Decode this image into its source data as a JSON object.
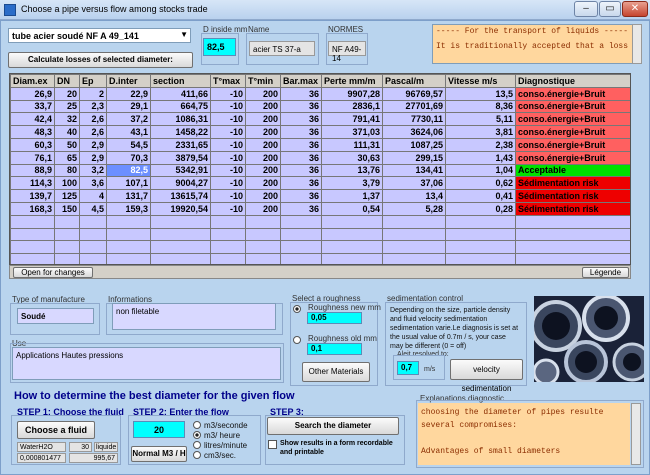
{
  "window": {
    "title": "Choose a pipe versus flow among stocks trade"
  },
  "stock": {
    "selected": "tube acier soudé NF A 49_141"
  },
  "dinside": {
    "label": "D inside mm",
    "value": "82,5"
  },
  "name": {
    "label": "Name",
    "value": "acier TS 37-a"
  },
  "normes": {
    "label": "NORMES",
    "value": "NF A49-14"
  },
  "notes": {
    "line1": "----- For the transport of liquids -----",
    "line2": "It is traditionally accepted that a loss of linear"
  },
  "calc_button": "Calculate losses of selected diameter:",
  "table": {
    "headers": [
      "Diam.ex",
      "DN",
      "Ep",
      "D.inter",
      "section",
      "T°max",
      "T°min",
      "Bar.max",
      "Perte mm/m",
      "Pascal/m",
      "Vitesse m/s",
      "Diagnostique"
    ],
    "rows": [
      {
        "cells": [
          "26,9",
          "20",
          "2",
          "22,9",
          "411,66",
          "-10",
          "200",
          "36",
          "9907,28",
          "96769,57",
          "13,5"
        ],
        "diag": "conso.énergie+Bruit",
        "status": "bad"
      },
      {
        "cells": [
          "33,7",
          "25",
          "2,3",
          "29,1",
          "664,75",
          "-10",
          "200",
          "36",
          "2836,1",
          "27701,69",
          "8,36"
        ],
        "diag": "conso.énergie+Bruit",
        "status": "bad"
      },
      {
        "cells": [
          "42,4",
          "32",
          "2,6",
          "37,2",
          "1086,31",
          "-10",
          "200",
          "36",
          "791,41",
          "7730,11",
          "5,11"
        ],
        "diag": "conso.énergie+Bruit",
        "status": "bad"
      },
      {
        "cells": [
          "48,3",
          "40",
          "2,6",
          "43,1",
          "1458,22",
          "-10",
          "200",
          "36",
          "371,03",
          "3624,06",
          "3,81"
        ],
        "diag": "conso.énergie+Bruit",
        "status": "bad"
      },
      {
        "cells": [
          "60,3",
          "50",
          "2,9",
          "54,5",
          "2331,65",
          "-10",
          "200",
          "36",
          "111,31",
          "1087,25",
          "2,38"
        ],
        "diag": "conso.énergie+Bruit",
        "status": "bad"
      },
      {
        "cells": [
          "76,1",
          "65",
          "2,9",
          "70,3",
          "3879,54",
          "-10",
          "200",
          "36",
          "30,63",
          "299,15",
          "1,43"
        ],
        "diag": "conso.énergie+Bruit",
        "status": "bad"
      },
      {
        "cells": [
          "88,9",
          "80",
          "3,2",
          "82,5",
          "5342,91",
          "-10",
          "200",
          "36",
          "13,76",
          "134,41",
          "1,04"
        ],
        "diag": "Acceptable",
        "status": "ok",
        "selected": true
      },
      {
        "cells": [
          "114,3",
          "100",
          "3,6",
          "107,1",
          "9004,27",
          "-10",
          "200",
          "36",
          "3,79",
          "37,06",
          "0,62"
        ],
        "diag": "Sédimentation risk",
        "status": "sed"
      },
      {
        "cells": [
          "139,7",
          "125",
          "4",
          "131,7",
          "13615,74",
          "-10",
          "200",
          "36",
          "1,37",
          "13,4",
          "0,41"
        ],
        "diag": "Sédimentation risk",
        "status": "sed"
      },
      {
        "cells": [
          "168,3",
          "150",
          "4,5",
          "159,3",
          "19920,54",
          "-10",
          "200",
          "36",
          "0,54",
          "5,28",
          "0,28"
        ],
        "diag": "Sédimentation risk",
        "status": "sed"
      }
    ],
    "empty_rows": 8
  },
  "open_changes": "Open for changes",
  "legende": "Légende",
  "manufacture": {
    "label": "Type of manufacture",
    "value": "Soudé"
  },
  "informations": {
    "label": "Informations",
    "value": "non filetable"
  },
  "use": {
    "label": "Use",
    "value": "Applications Hautes pressions"
  },
  "roughness": {
    "label": "Select a roughness",
    "new_label": "Roughness new mm",
    "new_value": "0,05",
    "old_label": "Roughness old mm",
    "old_value": "0,1",
    "other_button": "Other Materials"
  },
  "sedimentation": {
    "label": "sedimentation control",
    "text1": "Depending on the size, particle density",
    "text2": "and fluid velocity sedimentation",
    "text3": "sedimentation varie.Le diagnosis is set at",
    "text4": "the usual value of 0.7m / s, your case",
    "text5": "may be different (0 = off)",
    "alert_label": "Aleit resolved to:",
    "alert_value": "0,7",
    "unit": "m/s",
    "button": "velocity sedimentation"
  },
  "howto": {
    "title": "How to determine the best diameter for the given flow"
  },
  "step1": {
    "title": "STEP 1: Choose the fluid",
    "button": "Choose a fluid",
    "fluid": "WaterH2O",
    "temp": "30",
    "state": "liquide",
    "viscosity": "0,000801477",
    "density": "995,67"
  },
  "step2": {
    "title": "STEP 2: Enter the flow",
    "value": "20",
    "button": "Normal M3 / H",
    "units": [
      "m3/seconde",
      "m3/ heure",
      "litres/minute",
      "cm3/sec."
    ]
  },
  "step3": {
    "title": "STEP 3:",
    "button": "Search the diameter",
    "check1": "Show results in a form recordable",
    "check2": "and printable"
  },
  "explanations": {
    "label": "Explanations diagnostic",
    "line1": "choosing the diameter of pipes resulte",
    "line2": "several compromises:",
    "line3": "",
    "line4": "Advantages of small diameters"
  },
  "colors": {
    "bad": "#ff6060",
    "ok": "#00e000",
    "sed": "#ee0000"
  }
}
